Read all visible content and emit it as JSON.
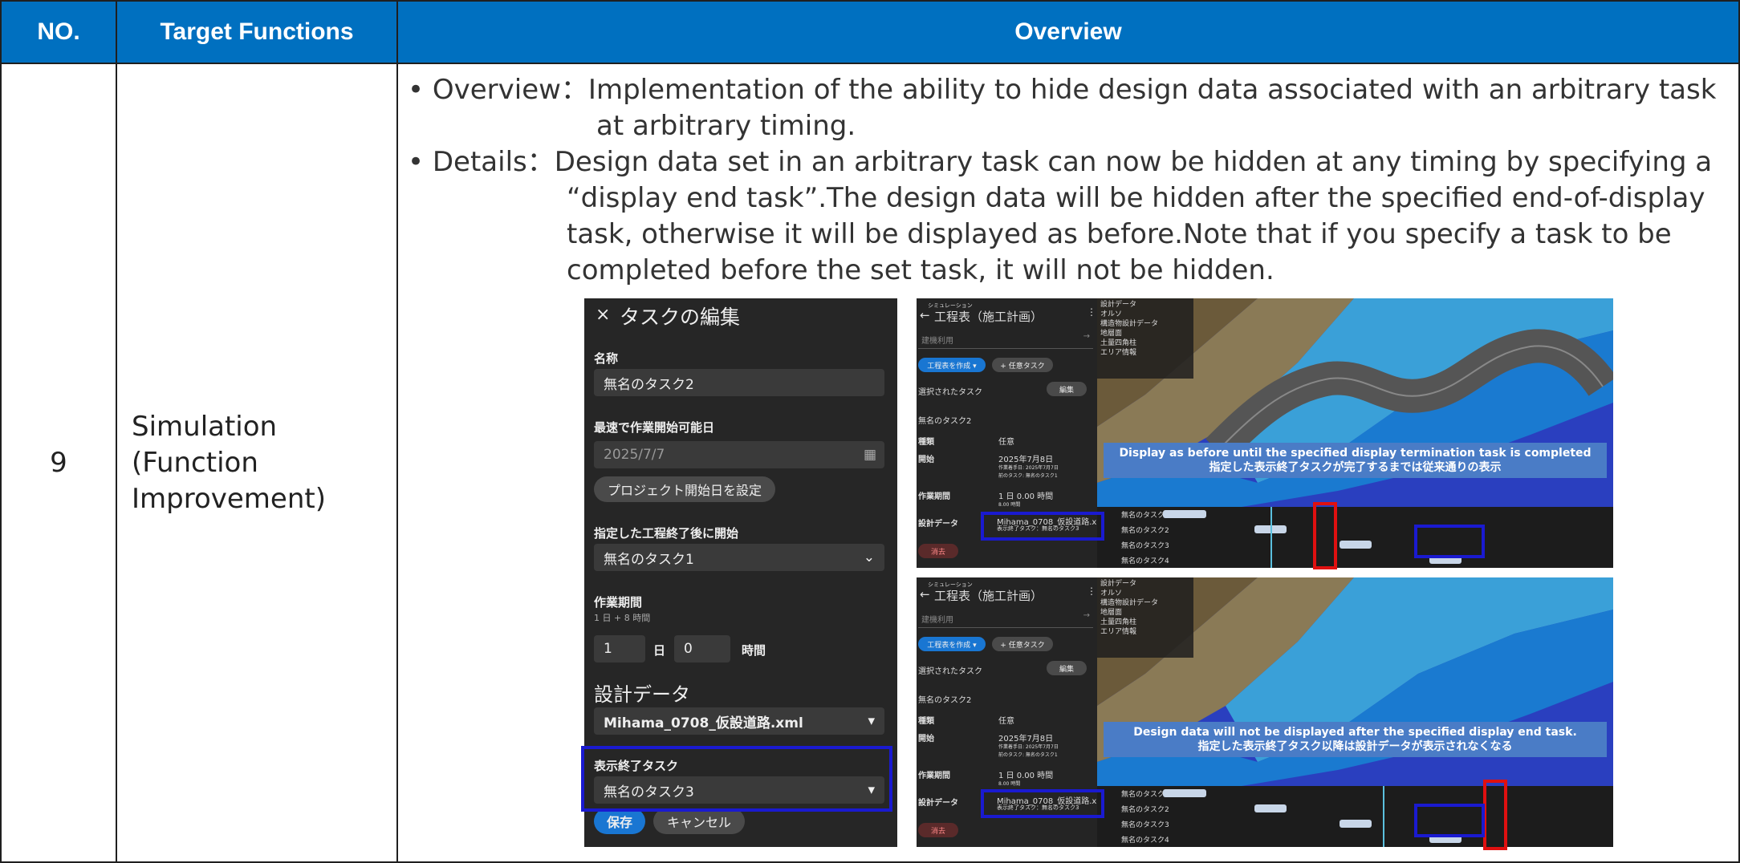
{
  "table": {
    "headers": {
      "no": "NO.",
      "functions": "Target Functions",
      "overview": "Overview"
    },
    "row": {
      "no": "9",
      "function_lines": [
        "Simulation",
        "(Function",
        "Improvement)"
      ],
      "overview_lines": [
        "• Overview：Implementation of the ability to hide design data associated with an arbitrary task",
        "at arbitrary timing.",
        "• Details：Design data set in an arbitrary task can now be hidden at any timing by specifying a",
        "“display end task”.The design data will be hidden after the specified end-of-display",
        "task, otherwise it will be displayed as before.Note that if you specify a task to be",
        "completed before the set task, it will not be hidden."
      ]
    }
  },
  "edit_panel": {
    "title": "タスクの編集",
    "name_label": "名称",
    "name_value": "無名のタスク2",
    "earliest_label": "最速で作業開始可能日",
    "earliest_value": "2025/7/7",
    "project_start_button": "プロジェクト開始日を設定",
    "start_after_label": "指定した工程終了後に開始",
    "start_after_value": "無名のタスク1",
    "duration_label": "作業期間",
    "duration_sub": "1 日 + 8 時間",
    "duration_days": "1",
    "day_unit": "日",
    "duration_hours": "0",
    "hour_unit": "時間",
    "design_label": "設計データ",
    "design_value": "Mihama_0708_仮設道路.xml",
    "end_task_label": "表示終了タスク",
    "end_task_value": "無名のタスク3",
    "save_button": "保存",
    "cancel_button": "キャンセル"
  },
  "sim_common": {
    "crumb": "シミュレーション",
    "title": "工程表（施工計画）",
    "search": "建機利用",
    "create_button": "工程表を作成 ▾",
    "any_task_button": "+ 任意タスク",
    "selected_label": "選択されたタスク",
    "edit_button": "編集",
    "task_name": "無名のタスク2",
    "type_label": "種類",
    "type_value": "任意",
    "start_label": "開始",
    "start_value": "2025年7月8日",
    "start_sub1": "作業着手日: 2025年7月7日",
    "start_sub2": "前のタスク: 無名のタスク1",
    "period_label": "作業期間",
    "period_value": "1 日 0.00 時間",
    "period_sub": "8.00 時間",
    "design_label": "設計データ",
    "design_file": "Mihama_0708_仮設道路.xml",
    "design_end": "表示終了タスク：無名のタスク3",
    "delete_button": "消去",
    "layers": [
      "設計データ",
      "オルソ",
      "構造物設計データ",
      "地層面",
      "土量四角柱",
      "エリア情報"
    ],
    "tasks": [
      "無名のタスク1",
      "無名のタスク2",
      "無名のタスク3",
      "無名のタスク4"
    ]
  },
  "sim_top": {
    "note_en": "Display as before until the specified display termination task is completed",
    "note_jp": "指定した表示終了タスクが完了するまでは従来通りの表示"
  },
  "sim_bottom": {
    "note_en": "Design data will not be displayed after the specified display end task.",
    "note_jp": "指定した表示終了タスク以降は設計データが表示されなくなる"
  },
  "colors": {
    "header_bg": "#0070c0",
    "highlight_blue": "#1a1ad0",
    "highlight_red": "#e01010",
    "note_bg": "#4a7cc6"
  }
}
